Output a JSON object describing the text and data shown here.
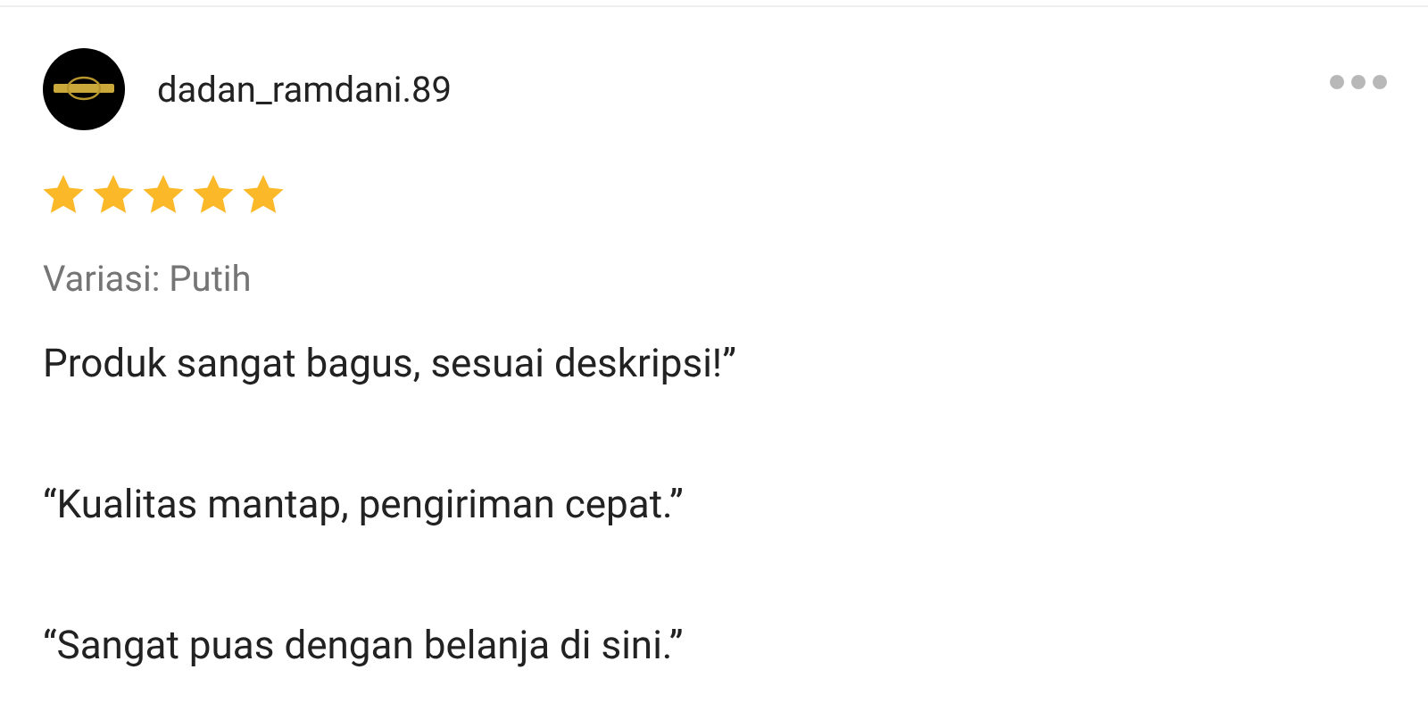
{
  "review": {
    "username": "dadan_ramdani.89",
    "stars": 5,
    "variation": "Variasi: Putih",
    "paragraphs": [
      "Produk sangat bagus, sesuai deskripsi!”",
      "“Kualitas mantap, pengiriman cepat.”",
      "“Sangat puas dengan belanja di sini.”"
    ]
  }
}
